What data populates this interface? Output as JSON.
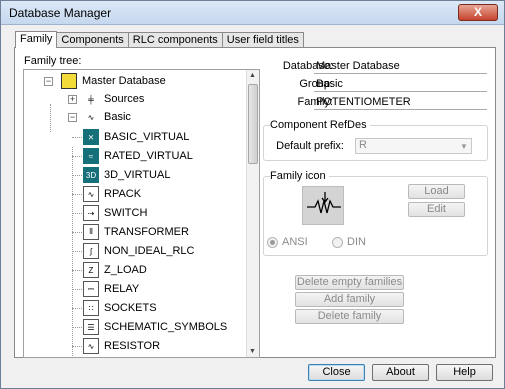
{
  "window": {
    "title": "Database Manager",
    "close_symbol": "X"
  },
  "tabs": [
    {
      "label": "Family",
      "active": true
    },
    {
      "label": "Components",
      "active": false
    },
    {
      "label": "RLC components",
      "active": false
    },
    {
      "label": "User field titles",
      "active": false
    }
  ],
  "tree": {
    "label": "Family tree:",
    "root": "Master Database",
    "sources": "Sources",
    "basic": "Basic",
    "items": [
      {
        "label": "BASIC_VIRTUAL",
        "icon": "basic-virtual-icon",
        "glyph": "⨯"
      },
      {
        "label": "RATED_VIRTUAL",
        "icon": "rated-virtual-icon",
        "glyph": "≈"
      },
      {
        "label": "3D_VIRTUAL",
        "icon": "3d-virtual-icon",
        "glyph": "3D"
      },
      {
        "label": "RPACK",
        "icon": "rpack-icon",
        "glyph": "∿"
      },
      {
        "label": "SWITCH",
        "icon": "switch-icon",
        "glyph": "⇢"
      },
      {
        "label": "TRANSFORMER",
        "icon": "transformer-icon",
        "glyph": "⫴"
      },
      {
        "label": "NON_IDEAL_RLC",
        "icon": "non-ideal-rlc-icon",
        "glyph": "ʃ"
      },
      {
        "label": "Z_LOAD",
        "icon": "z-load-icon",
        "glyph": "Z"
      },
      {
        "label": "RELAY",
        "icon": "relay-icon",
        "glyph": "⎓"
      },
      {
        "label": "SOCKETS",
        "icon": "sockets-icon",
        "glyph": "∷"
      },
      {
        "label": "SCHEMATIC_SYMBOLS",
        "icon": "schematic-symbols-icon",
        "glyph": "☰"
      },
      {
        "label": "RESISTOR",
        "icon": "resistor-icon",
        "glyph": "∿"
      }
    ]
  },
  "info": {
    "database_label": "Database:",
    "database_value": "Master Database",
    "group_label": "Group:",
    "group_value": "Basic",
    "family_label": "Family:",
    "family_value": "POTENTIOMETER"
  },
  "refdes": {
    "title": "Component RefDes",
    "prefix_label": "Default prefix:",
    "prefix_value": "R"
  },
  "family_icon": {
    "title": "Family icon",
    "load_label": "Load",
    "edit_label": "Edit",
    "ansi_label": "ANSI",
    "din_label": "DIN",
    "ansi_selected": true
  },
  "actions": {
    "delete_empty": "Delete empty families",
    "add_family": "Add family",
    "delete_family": "Delete family"
  },
  "footer": {
    "close": "Close",
    "about": "About",
    "help": "Help"
  }
}
